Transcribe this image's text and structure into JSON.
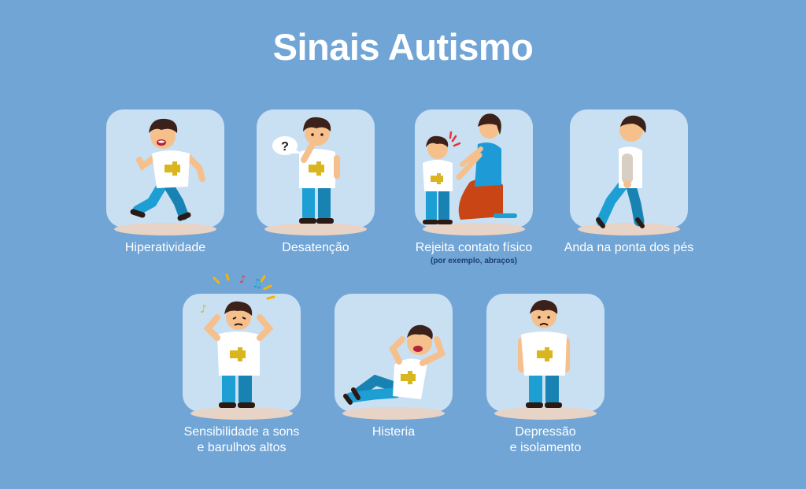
{
  "title": "Sinais Autismo",
  "colors": {
    "background": "#71a5d6",
    "tile": "#c9dff2",
    "shirt": "#ffffff",
    "pants": "#1d9fd4",
    "hair": "#3b2119",
    "skin": "#f6c08d",
    "puzzle": "#d9b51f"
  },
  "signs": [
    {
      "label": "Hiperatividade",
      "icon": "running-boy-illustration"
    },
    {
      "label": "Desatenção",
      "icon": "confused-boy-question-illustration",
      "bubble": "?"
    },
    {
      "label": "Rejeita contato físico",
      "sublabel": "(por exemplo, abraços)",
      "icon": "boy-rejecting-hug-illustration"
    },
    {
      "label": "Anda na ponta dos pés",
      "icon": "tiptoe-walking-boy-illustration"
    },
    {
      "label": "Sensibilidade a sons e barulhos altos",
      "label_line1": "Sensibilidade a sons",
      "label_line2": "e barulhos altos",
      "icon": "boy-covering-ears-illustration"
    },
    {
      "label": "Histeria",
      "icon": "boy-tantrum-on-floor-illustration"
    },
    {
      "label": "Depressão e isolamento",
      "label_line1": "Depressão",
      "label_line2": "e isolamento",
      "icon": "sad-boy-illustration"
    }
  ]
}
